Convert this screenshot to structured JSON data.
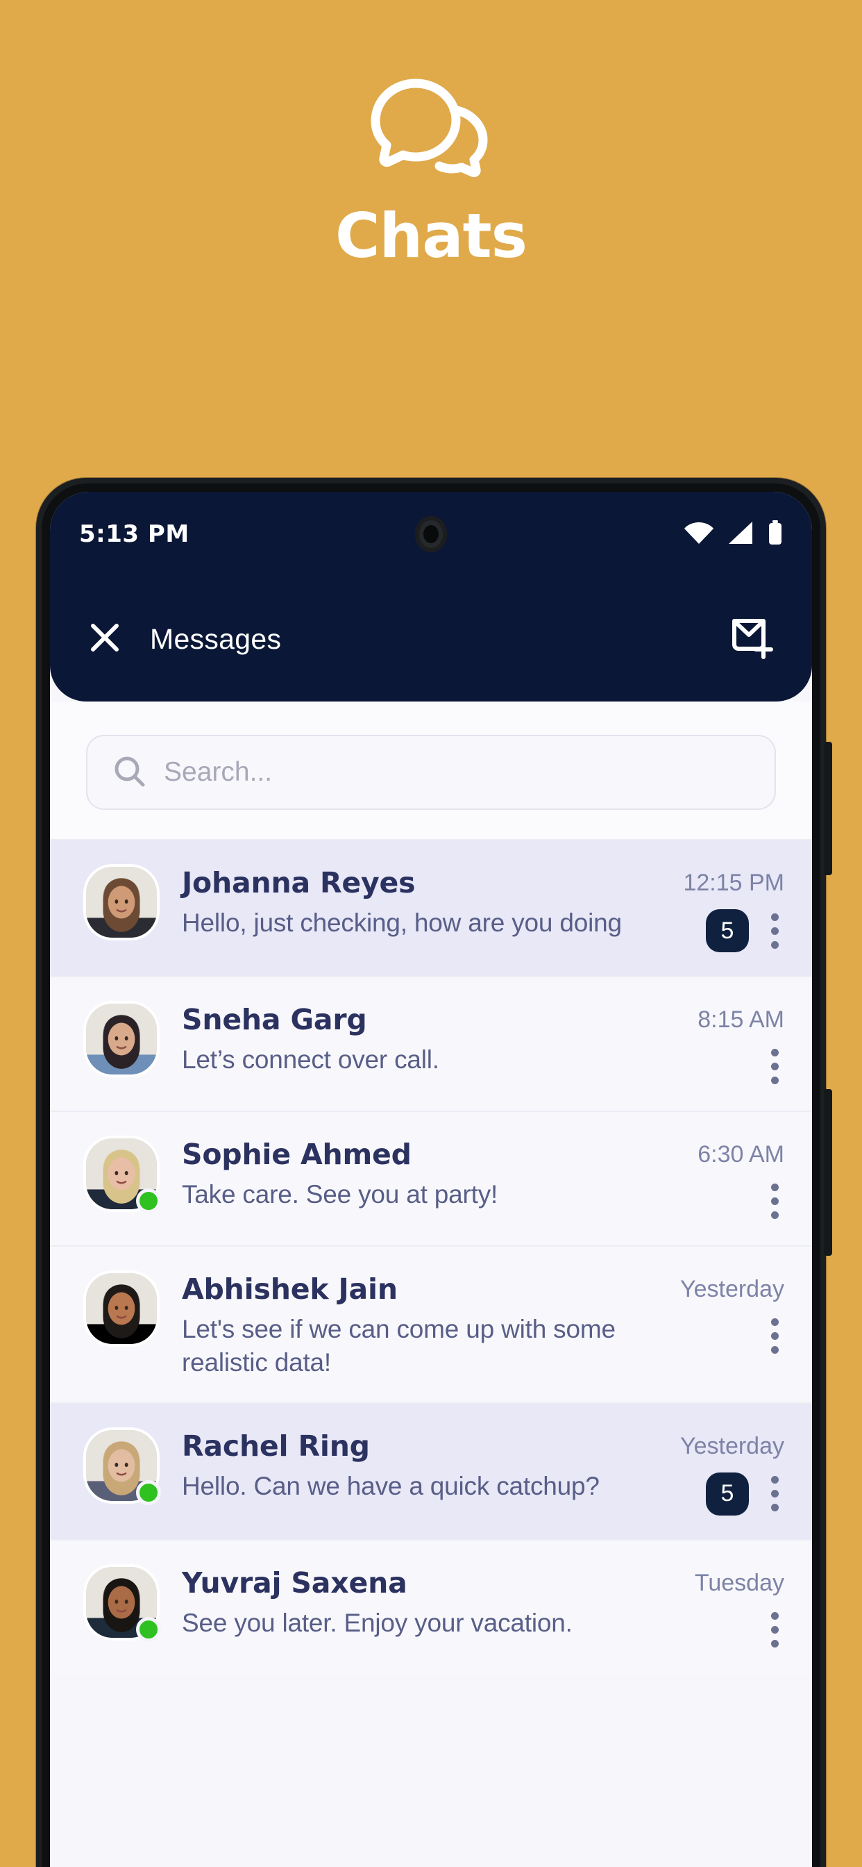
{
  "hero": {
    "title": "Chats",
    "logo_icon": "chat-bubbles-icon",
    "background_color": "#e0aa4b"
  },
  "statusbar": {
    "time": "5:13 PM",
    "icons": [
      "wifi-icon",
      "signal-icon",
      "battery-icon"
    ]
  },
  "appbar": {
    "close_icon": "close-icon",
    "title": "Messages",
    "compose_icon": "new-message-icon",
    "background_color": "#0b1736"
  },
  "search": {
    "icon": "search-icon",
    "placeholder": "Search...",
    "value": ""
  },
  "colors": {
    "accent": "#e0aa4b",
    "navy": "#0b1736",
    "badge": "#10213f",
    "unread_row": "#e8e8f7",
    "read_row": "#f8f8fc",
    "online": "#2fc11f"
  },
  "chats": [
    {
      "name": "Johanna Reyes",
      "message": "Hello, just checking, how are you doing",
      "time": "12:15 PM",
      "badge": "5",
      "unread": true,
      "online": false,
      "avatar": "woman-brown-hair"
    },
    {
      "name": "Sneha Garg",
      "message": "Let’s connect over call.",
      "time": "8:15 AM",
      "badge": "",
      "unread": false,
      "online": false,
      "avatar": "woman-dark-hair"
    },
    {
      "name": "Sophie Ahmed",
      "message": "Take care. See you at party!",
      "time": "6:30 AM",
      "badge": "",
      "unread": false,
      "online": true,
      "avatar": "woman-blonde"
    },
    {
      "name": "Abhishek Jain",
      "message": "Let's see if we can come up with some realistic data!",
      "time": "Yesterday",
      "badge": "",
      "unread": false,
      "online": false,
      "avatar": "man-suit"
    },
    {
      "name": "Rachel Ring",
      "message": "Hello. Can we have a quick catchup?",
      "time": "Yesterday",
      "badge": "5",
      "unread": true,
      "online": true,
      "avatar": "woman-glasses"
    },
    {
      "name": "Yuvraj Saxena",
      "message": "See you later. Enjoy your vacation.",
      "time": "Tuesday",
      "badge": "",
      "unread": false,
      "online": true,
      "avatar": "man-beard-glasses"
    }
  ]
}
